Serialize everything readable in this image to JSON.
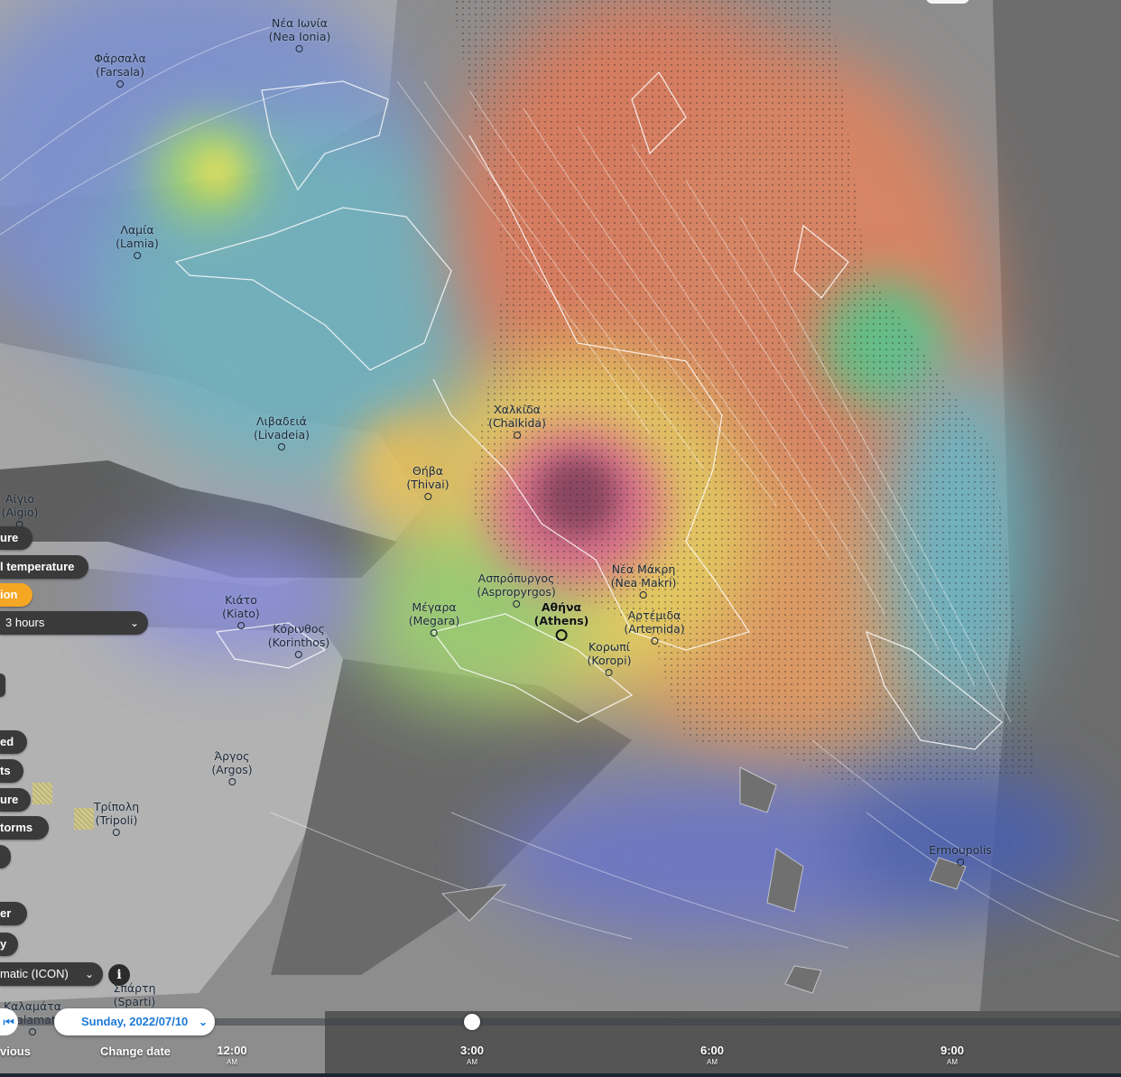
{
  "map": {
    "cities": [
      {
        "id": "nea-ionia",
        "name": "Νέα Ιωνία",
        "latin": "(Nea Ionia)"
      },
      {
        "id": "farsala",
        "name": "Φάρσαλα",
        "latin": "(Farsala)"
      },
      {
        "id": "lamia",
        "name": "Λαμία",
        "latin": "(Lamia)"
      },
      {
        "id": "livadeia",
        "name": "Λιβαδειά",
        "latin": "(Livadeia)"
      },
      {
        "id": "chalkida",
        "name": "Χαλκίδα",
        "latin": "(Chalkida)"
      },
      {
        "id": "thivai",
        "name": "Θήβα",
        "latin": "(Thivai)"
      },
      {
        "id": "aigio",
        "name": "Αίγιο",
        "latin": "(Aigio)"
      },
      {
        "id": "aspropyrgos",
        "name": "Ασπρόπυργος",
        "latin": "(Aspropyrgos)"
      },
      {
        "id": "nea-makri",
        "name": "Νέα Μάκρη",
        "latin": "(Nea Makri)"
      },
      {
        "id": "kiato",
        "name": "Κιάτο",
        "latin": "(Kiato)"
      },
      {
        "id": "megara",
        "name": "Μέγαρα",
        "latin": "(Megara)"
      },
      {
        "id": "athens",
        "name": "Αθήνα",
        "latin": "(Athens)"
      },
      {
        "id": "artemida",
        "name": "Αρτέμιδα",
        "latin": "(Artemida)"
      },
      {
        "id": "korinthos",
        "name": "Κόρινθος",
        "latin": "(Korinthos)"
      },
      {
        "id": "koropi",
        "name": "Κορωπί",
        "latin": "(Koropi)"
      },
      {
        "id": "argos",
        "name": "Άργος",
        "latin": "(Argos)"
      },
      {
        "id": "tripoli",
        "name": "Τρίπολη",
        "latin": "(Tripoli)"
      },
      {
        "id": "ermoupolis",
        "name": "",
        "latin": "Ermoupolis"
      },
      {
        "id": "sparti",
        "name": "Σπάρτη",
        "latin": "(Sparti)"
      },
      {
        "id": "kalamata",
        "name": "Καλαμάτα",
        "latin": "Kalamat"
      }
    ]
  },
  "sidebar": {
    "items": [
      {
        "label": "ure",
        "style": "normal"
      },
      {
        "label": "l temperature",
        "style": "normal"
      },
      {
        "label": "ion",
        "style": "active"
      },
      {
        "label": "3 hours",
        "style": "select"
      },
      {
        "label": "",
        "style": "normal"
      },
      {
        "label": "ed",
        "style": "normal"
      },
      {
        "label": "ts",
        "style": "normal"
      },
      {
        "label": "ure",
        "style": "normal"
      },
      {
        "label": "torms",
        "style": "normal"
      },
      {
        "label": "",
        "style": "normal"
      },
      {
        "label": "er",
        "style": "normal"
      },
      {
        "label": "y",
        "style": "normal"
      },
      {
        "label": "matic (ICON)",
        "style": "select"
      }
    ],
    "info_glyph": "i",
    "chevron": "⌄"
  },
  "timeline": {
    "date": "Sunday, 2022/07/10",
    "previous_label": "vious",
    "change_date_label": "Change date",
    "prev_glyph": "⏮",
    "ticks": [
      {
        "time": "12:00",
        "ampm": "AM"
      },
      {
        "time": "3:00",
        "ampm": "AM"
      },
      {
        "time": "6:00",
        "ampm": "AM"
      },
      {
        "time": "9:00",
        "ampm": "AM"
      }
    ],
    "position_fraction": 0.333
  },
  "colors": {
    "active": "#f5a623",
    "link_blue": "#1d7ad6",
    "pill_bg": "#3a3a3a"
  }
}
